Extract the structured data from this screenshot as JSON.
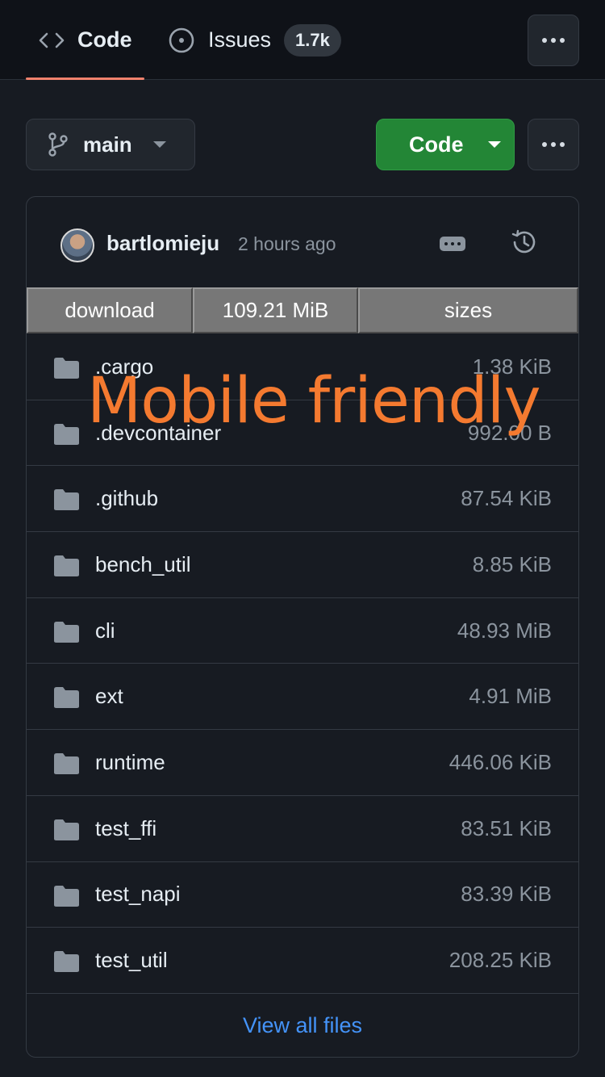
{
  "tabs": {
    "code": {
      "label": "Code",
      "icon": "code-icon"
    },
    "issues": {
      "label": "Issues",
      "icon": "issue-opened-icon",
      "count": "1.7k"
    }
  },
  "branch": {
    "label": "main",
    "icon": "git-branch-icon"
  },
  "code_button": {
    "label": "Code"
  },
  "commit": {
    "author": "bartlomieju",
    "time": "2 hours ago"
  },
  "stats": {
    "cells": [
      "download",
      "109.21 MiB",
      "sizes"
    ]
  },
  "files": [
    {
      "name": ".cargo",
      "size": "1.38 KiB"
    },
    {
      "name": ".devcontainer",
      "size": "992.00 B"
    },
    {
      "name": ".github",
      "size": "87.54 KiB"
    },
    {
      "name": "bench_util",
      "size": "8.85 KiB"
    },
    {
      "name": "cli",
      "size": "48.93 MiB"
    },
    {
      "name": "ext",
      "size": "4.91 MiB"
    },
    {
      "name": "runtime",
      "size": "446.06 KiB"
    },
    {
      "name": "test_ffi",
      "size": "83.51 KiB"
    },
    {
      "name": "test_napi",
      "size": "83.39 KiB"
    },
    {
      "name": "test_util",
      "size": "208.25 KiB"
    }
  ],
  "view_all": {
    "label": "View all files"
  },
  "overlay": {
    "text": "Mobile friendly"
  },
  "colors": {
    "background": "#171b22",
    "accent_green": "#238636",
    "link_blue": "#4493f8",
    "overlay_orange": "#f47a30",
    "tab_underline": "#f0826d"
  }
}
